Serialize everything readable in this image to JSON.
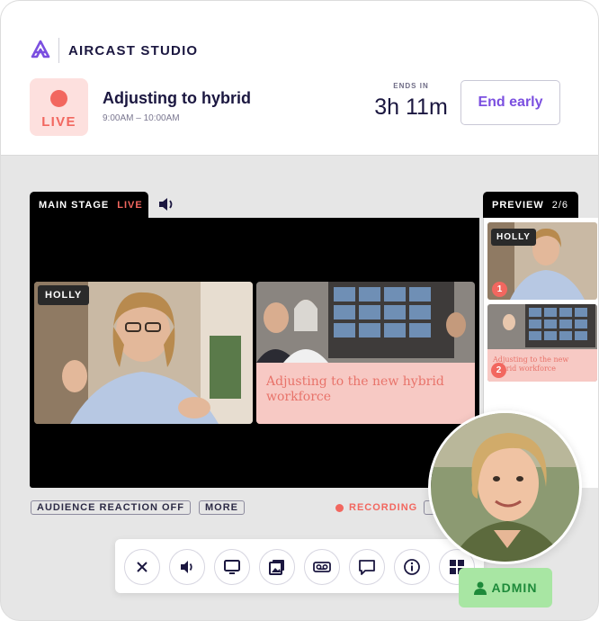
{
  "brand": {
    "name": "AIRCAST STUDIO"
  },
  "session": {
    "live_label": "LIVE",
    "title": "Adjusting to hybrid",
    "time": "9:00AM – 10:00AM",
    "ends_in_label": "ENDS IN",
    "ends_in_value": "3h 11m",
    "end_early_label": "End early"
  },
  "stage": {
    "tab_label": "MAIN STAGE",
    "tab_live": "LIVE",
    "speaker_name": "HOLLY",
    "slide_text": "Adjusting to the new hybrid workforce"
  },
  "preview": {
    "tab_label": "PREVIEW",
    "count": "2/6",
    "items": [
      {
        "number": "1",
        "speaker_name": "HOLLY"
      },
      {
        "number": "2",
        "slide_text": "Adjusting to the new hybrid workforce"
      }
    ]
  },
  "controls": {
    "audience_reaction": "AUDIENCE REACTION OFF",
    "more": "MORE",
    "recording": "RECORDING"
  },
  "toolbar": {
    "buttons": [
      "close-icon",
      "speaker-icon",
      "screen-share-icon",
      "media-icon",
      "voicemail-icon",
      "chat-icon",
      "info-icon",
      "grid-icon"
    ]
  },
  "user": {
    "role": "ADMIN"
  },
  "colors": {
    "accent": "#7b4fe0",
    "live": "#f2675f",
    "admin_bg": "#a8e6a3",
    "admin_text": "#1e8a3a"
  }
}
